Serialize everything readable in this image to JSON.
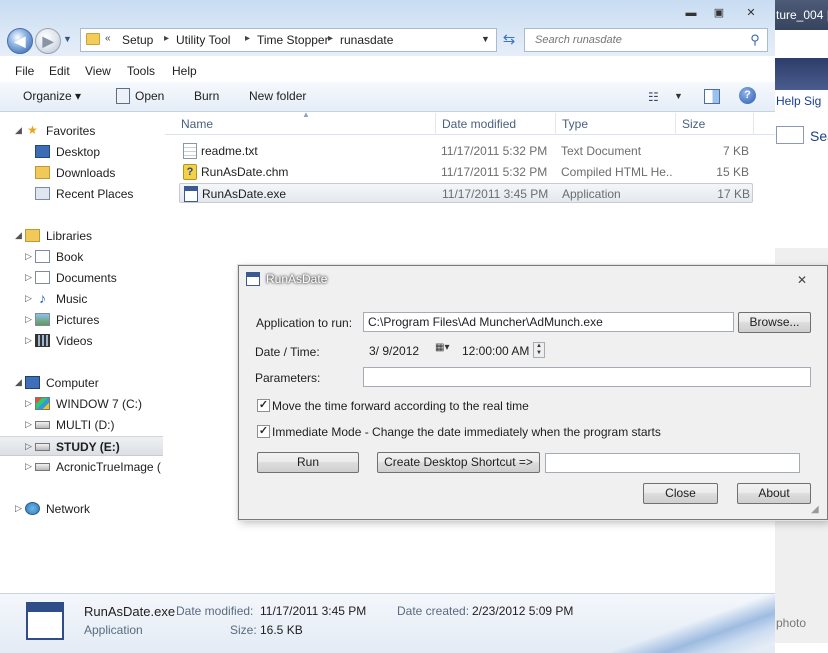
{
  "background_window": {
    "title": "ture_004 |",
    "menu": "Help  Sig",
    "search_text": "Sea",
    "footer_text": "photo"
  },
  "explorer": {
    "caption_buttons": {
      "minimize": "▬",
      "maximize": "▣",
      "close": "✕"
    },
    "address": {
      "chevron": "«",
      "crumbs": [
        "Setup",
        "Utility Tool",
        "Time Stopper",
        "runasdate"
      ],
      "separator": "▸"
    },
    "search": {
      "placeholder": "Search runasdate"
    },
    "menu": [
      "File",
      "Edit",
      "View",
      "Tools",
      "Help"
    ],
    "toolbar": {
      "organize": "Organize ▾",
      "open": "Open",
      "burn": "Burn",
      "new_folder": "New folder"
    },
    "nav": {
      "favorites": "Favorites",
      "desktop": "Desktop",
      "downloads": "Downloads",
      "recent_places": "Recent Places",
      "libraries": "Libraries",
      "book": "Book",
      "documents": "Documents",
      "music": "Music",
      "pictures": "Pictures",
      "videos": "Videos",
      "computer": "Computer",
      "drive_c": "WINDOW 7 (C:)",
      "drive_d": "MULTI (D:)",
      "drive_e": "STUDY (E:)",
      "drive_acronis": "AcronicTrueImage (",
      "network": "Network"
    },
    "columns": {
      "name": "Name",
      "date": "Date modified",
      "type": "Type",
      "size": "Size"
    },
    "files": [
      {
        "name": "readme.txt",
        "date": "11/17/2011 5:32 PM",
        "type": "Text Document",
        "size": "7 KB",
        "icon": "text-file-icon"
      },
      {
        "name": "RunAsDate.chm",
        "date": "11/17/2011 5:32 PM",
        "type": "Compiled HTML He...",
        "size": "15 KB",
        "icon": "help-file-icon"
      },
      {
        "name": "RunAsDate.exe",
        "date": "11/17/2011 3:45 PM",
        "type": "Application",
        "size": "17 KB",
        "icon": "application-icon"
      }
    ],
    "details": {
      "filename": "RunAsDate.exe",
      "type": "Application",
      "date_modified_label": "Date modified:",
      "date_modified": "11/17/2011 3:45 PM",
      "date_created_label": "Date created:",
      "date_created": "2/23/2012 5:09 PM",
      "size_label": "Size:",
      "size": "16.5 KB"
    }
  },
  "dialog": {
    "title": "RunAsDate",
    "close": "✕",
    "app_label": "Application to run:",
    "app_value": "C:\\Program Files\\Ad Muncher\\AdMunch.exe",
    "browse": "Browse...",
    "datetime_label": "Date / Time:",
    "date_value": "3/  9/2012",
    "time_value": "12:00:00 AM",
    "params_label": "Parameters:",
    "params_value": "",
    "move_time_label": "Move the time forward according to the real time",
    "move_time_checked": true,
    "immediate_label": "Immediate Mode - Change the date immediately when the program starts",
    "immediate_checked": true,
    "run": "Run",
    "shortcut": "Create Desktop Shortcut =>",
    "shortcut_name": "",
    "close_button": "Close",
    "about": "About"
  }
}
